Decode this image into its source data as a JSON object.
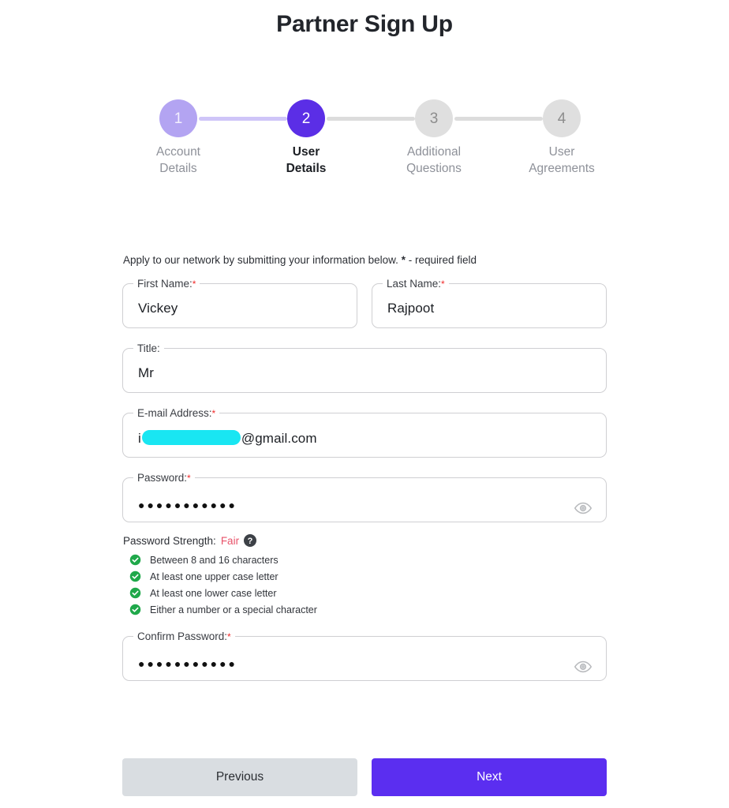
{
  "page": {
    "title": "Partner Sign Up"
  },
  "stepper": {
    "steps": [
      {
        "number": "1",
        "line1": "Account",
        "line2": "Details",
        "state": "done"
      },
      {
        "number": "2",
        "line1": "User",
        "line2": "Details",
        "state": "active"
      },
      {
        "number": "3",
        "line1": "Additional",
        "line2": "Questions",
        "state": "todo"
      },
      {
        "number": "4",
        "line1": "User",
        "line2": "Agreements",
        "state": "todo"
      }
    ],
    "colors": {
      "done": "#b3a4f2",
      "active": "#5b2ee6",
      "todo": "#dfdfdf",
      "connector_filled": "#cfc5f8",
      "connector_empty": "#dcdcdc"
    }
  },
  "form": {
    "intro_text": "Apply to our network by submitting your information below. ",
    "intro_star": "*",
    "intro_suffix": " - required field",
    "fields": {
      "first_name": {
        "label": "First Name:",
        "required": "*",
        "value": "Vickey"
      },
      "last_name": {
        "label": "Last Name:",
        "required": "*",
        "value": "Rajpoot"
      },
      "title": {
        "label": "Title:",
        "required": "",
        "value": "Mr"
      },
      "email": {
        "label": "E-mail Address:",
        "required": "*",
        "value_prefix": "i",
        "value_suffix": "@gmail.com",
        "redaction_color": "#19e6f2"
      },
      "password": {
        "label": "Password:",
        "required": "*",
        "value": "●●●●●●●●●●●"
      },
      "confirm_password": {
        "label": "Confirm Password:",
        "required": "*",
        "value": "●●●●●●●●●●●"
      }
    },
    "password_strength": {
      "label": "Password Strength:",
      "value": "Fair",
      "value_color": "#e8536a",
      "help_icon": "question-mark-circle-icon"
    },
    "requirements": [
      {
        "text": "Between 8 and 16 characters",
        "met": true
      },
      {
        "text": "At least one upper case letter",
        "met": true
      },
      {
        "text": "At least one lower case letter",
        "met": true
      },
      {
        "text": "Either a number or a special character",
        "met": true
      }
    ],
    "requirement_met_color": "#1fa84a"
  },
  "actions": {
    "previous_label": "Previous",
    "next_label": "Next",
    "previous_color": "#d9dde1",
    "next_color": "#5b2ef0"
  }
}
